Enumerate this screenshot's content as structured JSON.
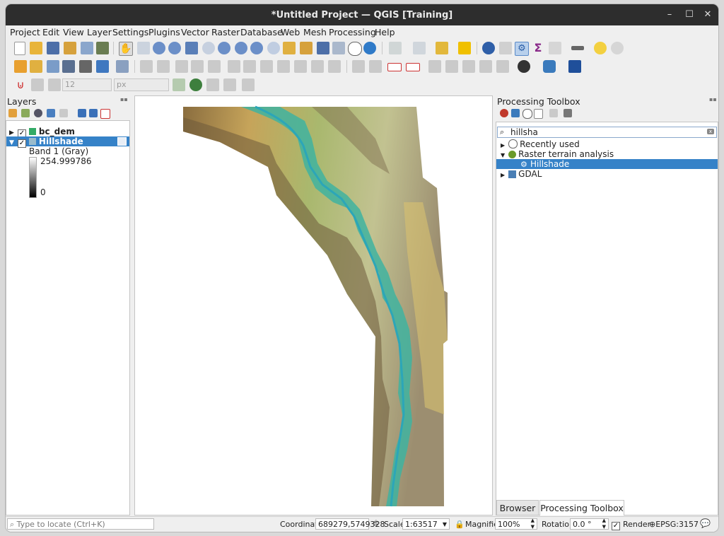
{
  "window": {
    "title": "*Untitled Project — QGIS [Training]"
  },
  "menu": [
    "Project",
    "Edit",
    "View",
    "Layer",
    "Settings",
    "Plugins",
    "Vector",
    "Raster",
    "Database",
    "Web",
    "Mesh",
    "Processing",
    "Help"
  ],
  "toolbar3": {
    "size_value": "12",
    "unit": "px"
  },
  "layers_panel": {
    "title": "Layers",
    "items": [
      {
        "name": "bc_dem",
        "checked": true
      },
      {
        "name": "Hillshade",
        "checked": true
      }
    ],
    "legend": {
      "band": "Band 1 (Gray)",
      "max": "254.999786",
      "min": "0"
    }
  },
  "toolbox": {
    "title": "Processing Toolbox",
    "search_value": "hillsha",
    "tree": {
      "recently_used": "Recently used",
      "raster_terrain": "Raster terrain analysis",
      "hillshade": "Hillshade",
      "gdal": "GDAL"
    },
    "tabs": [
      "Browser",
      "Processing Toolbox"
    ]
  },
  "statusbar": {
    "locate_placeholder": "Type to locate (Ctrl+K)",
    "coordinate_label": "Coordinate",
    "coordinate_value": "689279,5749328",
    "scale_label": "Scale",
    "scale_value": "1:63517",
    "magnifier_label": "Magnifier",
    "magnifier_value": "100%",
    "rotation_label": "Rotation",
    "rotation_value": "0.0 °",
    "render_label": "Render",
    "crs": "EPSG:3157"
  }
}
